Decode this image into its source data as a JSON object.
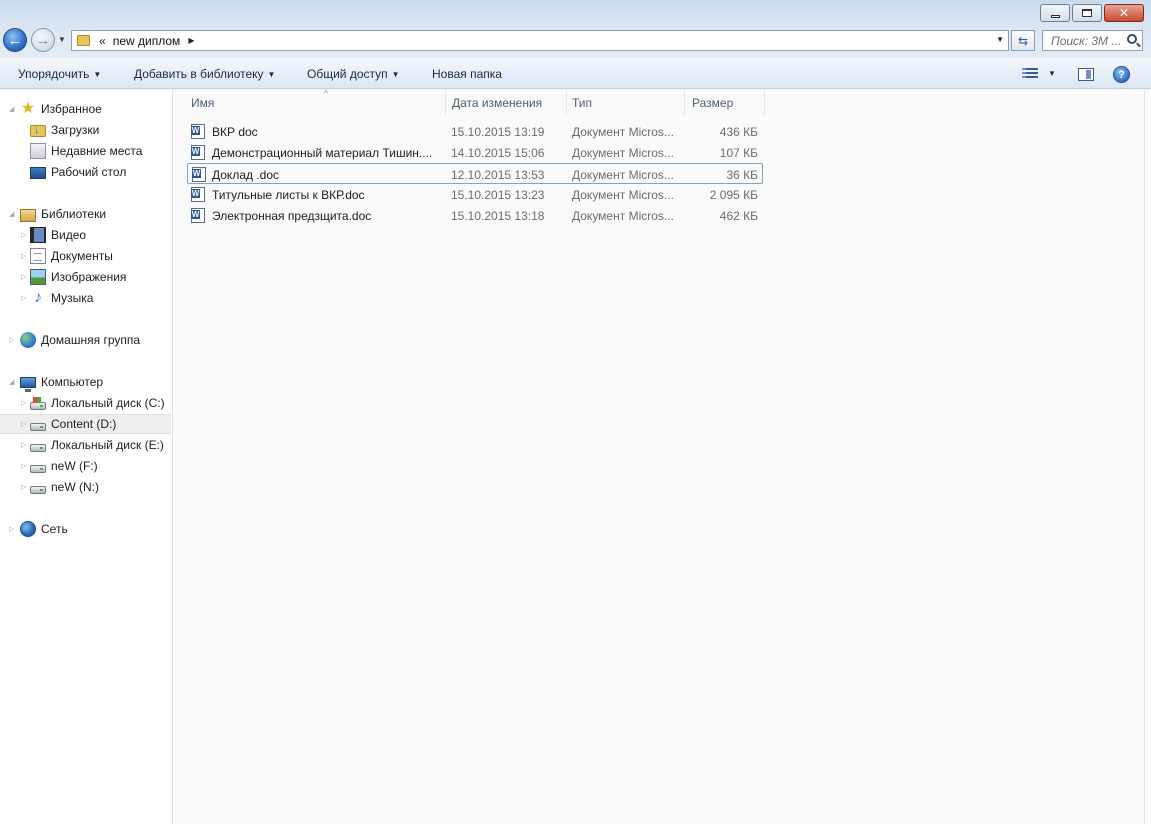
{
  "address": {
    "chevron": "«",
    "path": "new диплом"
  },
  "search": {
    "placeholder": "Поиск: 3М ..."
  },
  "toolbar": {
    "organize": "Упорядочить",
    "add_to_library": "Добавить в библиотеку",
    "share": "Общий доступ",
    "new_folder": "Новая папка"
  },
  "nav": {
    "favorites": "Избранное",
    "downloads": "Загрузки",
    "recent": "Недавние места",
    "desktop": "Рабочий стол",
    "libraries": "Библиотеки",
    "video": "Видео",
    "documents": "Документы",
    "pictures": "Изображения",
    "music": "Музыка",
    "homegroup": "Домашняя группа",
    "computer": "Компьютер",
    "drive_c": "Локальный диск (C:)",
    "drive_d": "Content (D:)",
    "drive_e": "Локальный диск (E:)",
    "drive_f": "neW (F:)",
    "drive_n": "neW (N:)",
    "network": "Сеть"
  },
  "columns": {
    "name": "Имя",
    "date": "Дата изменения",
    "type": "Тип",
    "size": "Размер"
  },
  "files": [
    {
      "name": "ВКР             doc",
      "date": "15.10.2015 13:19",
      "type": "Документ Micros...",
      "size": "436 КБ"
    },
    {
      "name": "Демонстрационный материал Тишин....",
      "date": "14.10.2015 15:06",
      "type": "Документ Micros...",
      "size": "107 КБ"
    },
    {
      "name": "Доклад             .doc",
      "date": "12.10.2015 13:53",
      "type": "Документ Micros...",
      "size": "36 КБ"
    },
    {
      "name": "Титульные  листы к ВКР.doc",
      "date": "15.10.2015 13:23",
      "type": "Документ Micros...",
      "size": "2 095 КБ"
    },
    {
      "name": "Электронная предзщита.doc",
      "date": "15.10.2015 13:18",
      "type": "Документ Micros...",
      "size": "462 КБ"
    }
  ],
  "colors": {
    "selection_border": "#7da2ce",
    "header_text": "#4c607a",
    "secondary_text": "#6d6d6d"
  }
}
